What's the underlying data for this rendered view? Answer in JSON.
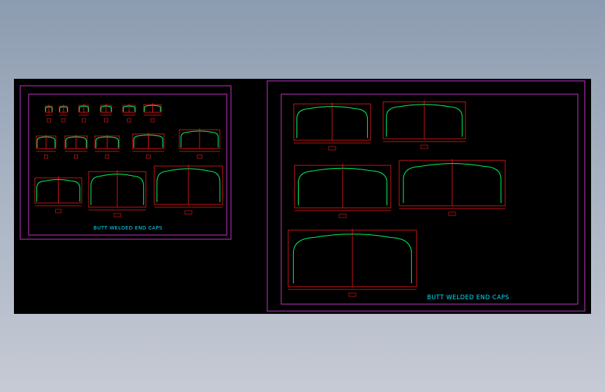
{
  "sheets": [
    {
      "title": "BUTT WELDED END CAPS"
    },
    {
      "title": "BUTT WELDED END CAPS"
    }
  ],
  "colors": {
    "background": "#000000",
    "frame": "#cc33cc",
    "dimension": "#ff1a1a",
    "profile": "#00ff66",
    "text": "#00e5ff"
  }
}
